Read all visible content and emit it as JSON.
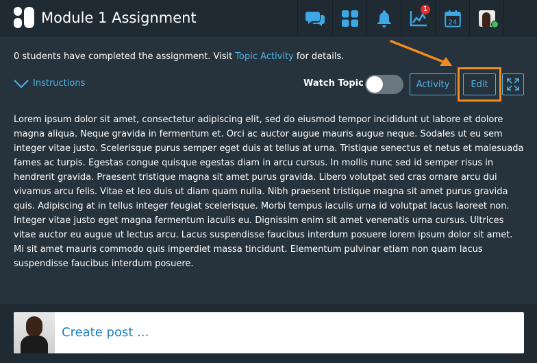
{
  "header": {
    "title": "Module 1 Assignment",
    "notification_count": "1",
    "calendar_day": "24",
    "icons": [
      "chat-icon",
      "apps-grid-icon",
      "bell-icon",
      "chart-icon",
      "calendar-icon",
      "user-avatar"
    ]
  },
  "completion": {
    "prefix": "0 students have completed the assignment. Visit ",
    "link": "Topic Activity",
    "suffix": " for details."
  },
  "toolbar": {
    "instructions_label": "Instructions",
    "watch_topic_label": "Watch Topic",
    "watch_topic_on": false,
    "activity_label": "Activity",
    "edit_label": "Edit"
  },
  "content": {
    "body": "Lorem ipsum dolor sit amet, consectetur adipiscing elit, sed do eiusmod tempor incididunt ut labore et dolore magna aliqua. Neque gravida in fermentum et. Orci ac auctor augue mauris augue neque. Sodales ut eu sem integer vitae justo. Scelerisque purus semper eget duis at tellus at urna. Tristique senectus et netus et malesuada fames ac turpis. Egestas congue quisque egestas diam in arcu cursus. In mollis nunc sed id semper risus in hendrerit gravida. Praesent tristique magna sit amet purus gravida. Libero volutpat sed cras ornare arcu dui vivamus arcu felis. Vitae et leo duis ut diam quam nulla. Nibh praesent tristique magna sit amet purus gravida quis. Adipiscing at in tellus integer feugiat scelerisque. Morbi tempus iaculis urna id volutpat lacus laoreet non. Integer vitae justo eget magna fermentum iaculis eu. Dignissim enim sit amet venenatis urna cursus. Ultrices vitae auctor eu augue ut lectus arcu. Lacus suspendisse faucibus interdum posuere lorem ipsum dolor sit amet. Mi sit amet mauris commodo quis imperdiet massa tincidunt. Elementum pulvinar etiam non quam lacus suspendisse faucibus interdum posuere."
  },
  "composer": {
    "create_post_label": "Create post ..."
  },
  "colors": {
    "background": "#26323c",
    "header": "#1f2a33",
    "accent": "#4fb3e8",
    "highlight": "#f28c1e",
    "badge": "#e52b2b",
    "presence": "#3bbf5a"
  }
}
